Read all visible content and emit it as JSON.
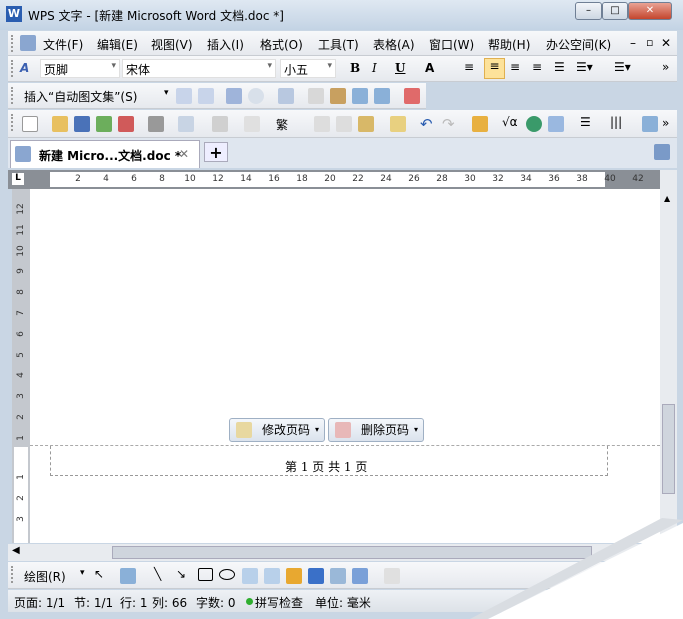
{
  "window": {
    "title": "WPS 文字 - [新建 Microsoft Word 文档.doc *]",
    "app_icon": "W",
    "minimize": "–",
    "maximize": "□",
    "close": "✕"
  },
  "menu": [
    "文件(F)",
    "编辑(E)",
    "视图(V)",
    "插入(I)",
    "格式(O)",
    "工具(T)",
    "表格(A)",
    "窗口(W)",
    "帮助(H)",
    "办公空间(K)"
  ],
  "format": {
    "style": "页脚",
    "font": "宋体",
    "size": "小五",
    "bold": "B",
    "italic": "I",
    "underline": "U",
    "fontcolor": "A",
    "more": "»"
  },
  "autotext": {
    "insert_label": "插入“自动图文集”(S)"
  },
  "standard": {
    "traditional": "繁",
    "more": "»"
  },
  "tabs": {
    "doc_tab": "新建 Micro...文档.doc *",
    "close": "✕",
    "new": "+"
  },
  "ruler": {
    "h": [
      "2",
      "4",
      "6",
      "8",
      "10",
      "12",
      "14",
      "16",
      "18",
      "20",
      "22",
      "24",
      "26",
      "28",
      "30",
      "32",
      "34",
      "36",
      "38",
      "40",
      "42"
    ],
    "v_top": [
      "12",
      "11",
      "10",
      "9",
      "8",
      "7",
      "6",
      "5",
      "4",
      "3",
      "2",
      "1"
    ],
    "v_bottom": [
      "1",
      "2",
      "3"
    ]
  },
  "header_footer": {
    "edit_page_number": "修改页码",
    "delete_page_number": "删除页码",
    "footer_text": "第 1 页 共 1 页"
  },
  "draw": {
    "label": "绘图(R)"
  },
  "status": {
    "page": "页面: 1/1",
    "section": "节: 1/1",
    "row": "行: 1",
    "col": "列: 66",
    "words": "字数: 0",
    "spell": "拼写检查",
    "unit": "单位: 毫米"
  },
  "colors": {
    "accent": "#2a5db0",
    "status_green": "#2fae2f"
  }
}
